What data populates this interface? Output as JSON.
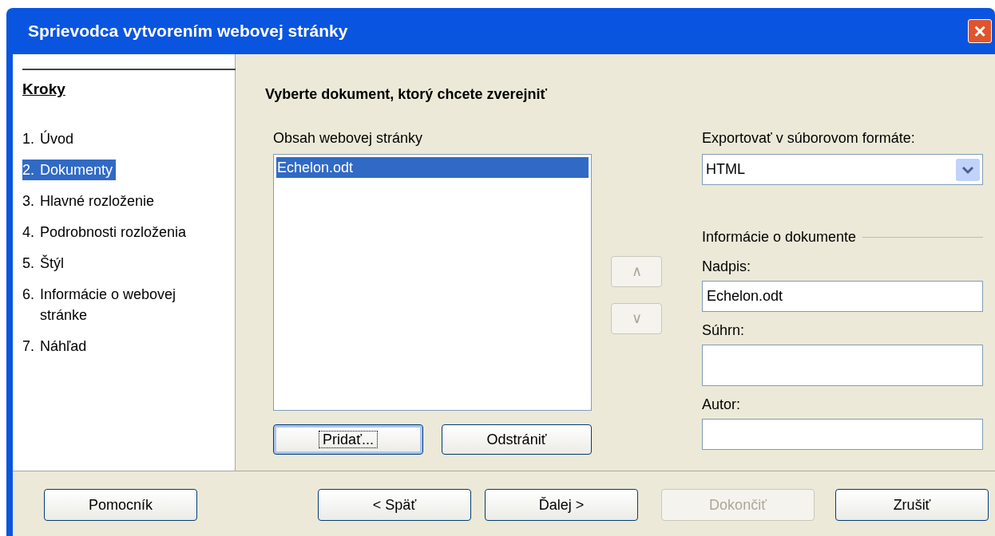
{
  "window": {
    "title": "Sprievodca vytvorením webovej stránky",
    "close": "×"
  },
  "steps": {
    "title": "Kroky",
    "items": [
      {
        "number": "1.",
        "label": "Úvod",
        "selected": false
      },
      {
        "number": "2.",
        "label": "Dokumenty",
        "selected": true
      },
      {
        "number": "3.",
        "label": "Hlavné rozloženie",
        "selected": false
      },
      {
        "number": "4.",
        "label": "Podrobnosti rozloženia",
        "selected": false
      },
      {
        "number": "5.",
        "label": "Štýl",
        "selected": false
      },
      {
        "number": "6.",
        "label": "Informácie o webovej stránke",
        "selected": false
      },
      {
        "number": "7.",
        "label": "Náhľad",
        "selected": false
      }
    ]
  },
  "heading": "Vyberte dokument, ktorý chcete zverejniť",
  "content_list": {
    "label": "Obsah webovej stránky",
    "items": [
      {
        "text": "Echelon.odt",
        "selected": true
      }
    ],
    "buttons": [
      {
        "label": "Pridať...",
        "focused": true,
        "disabled": false
      },
      {
        "label": "Odstrániť",
        "focused": false,
        "disabled": false
      }
    ]
  },
  "move_buttons": [
    {
      "label": "∧",
      "disabled": true
    },
    {
      "label": "∨",
      "disabled": true
    }
  ],
  "export": {
    "label": "Exportovať v súborovom formáte:",
    "value": "HTML"
  },
  "document_info": {
    "title": "Informácie o dokumente",
    "fields": [
      {
        "label": "Nadpis:",
        "value": "Echelon.odt",
        "kind": "single"
      },
      {
        "label": "Súhrn:",
        "kind": "multi"
      },
      {
        "label": "Autor:",
        "kind": "single"
      }
    ]
  },
  "footer_buttons": [
    {
      "label": "Pomocník",
      "disabled": false
    },
    {
      "label": "< Späť",
      "disabled": false
    },
    {
      "label": "Ďalej >",
      "disabled": false
    },
    {
      "label": "Dokončiť",
      "disabled": true
    },
    {
      "label": "Zrušiť",
      "disabled": false
    }
  ]
}
